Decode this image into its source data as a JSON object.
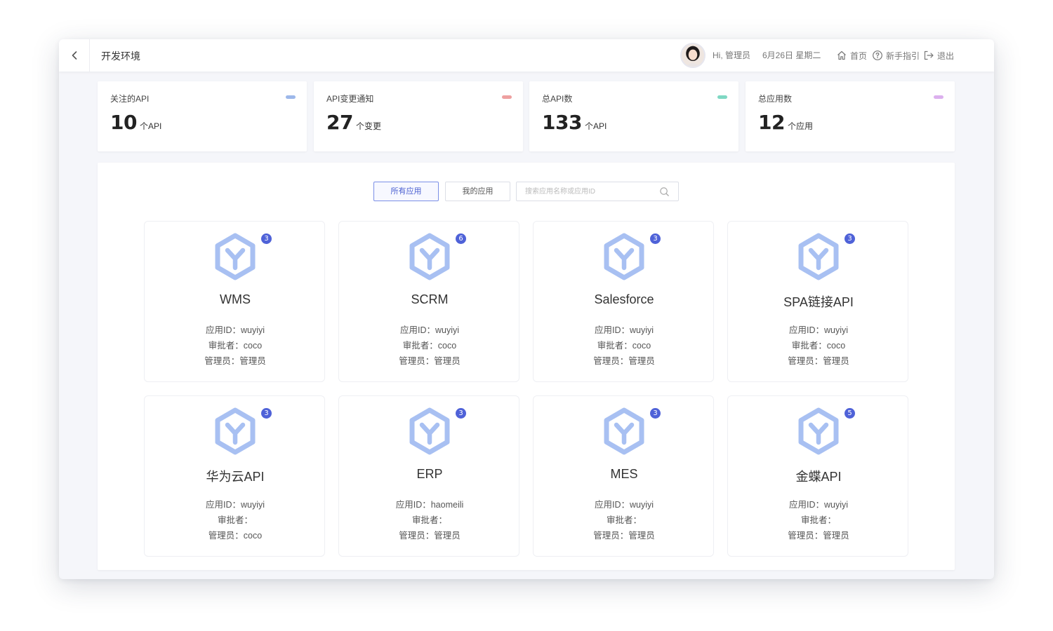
{
  "header": {
    "title": "开发环境",
    "greeting": "Hi, 管理员",
    "date": "6月26日 星期二",
    "home_label": "首页",
    "guide_label": "新手指引",
    "logout_label": "退出"
  },
  "stats": [
    {
      "label": "关注的API",
      "value": "10",
      "unit": "个API",
      "color": "#9db8ea"
    },
    {
      "label": "API变更通知",
      "value": "27",
      "unit": "个变更",
      "color": "#eea0a0"
    },
    {
      "label": "总API数",
      "value": "133",
      "unit": "个API",
      "color": "#7fd8c3"
    },
    {
      "label": "总应用数",
      "value": "12",
      "unit": "个应用",
      "color": "#dcb0ee"
    }
  ],
  "filters": {
    "all_label": "所有应用",
    "mine_label": "我的应用",
    "search_placeholder": "搜索应用名称或应用ID"
  },
  "colors": {
    "accent": "#4f62d8",
    "icon": "#a8c0f2"
  },
  "apps": [
    {
      "name": "WMS",
      "badge": "3",
      "app_id": "应用ID：wuyiyi",
      "approver": "审批者：coco",
      "admin": "管理员：管理员"
    },
    {
      "name": "SCRM",
      "badge": "6",
      "app_id": "应用ID：wuyiyi",
      "approver": "审批者：coco",
      "admin": "管理员：管理员"
    },
    {
      "name": "Salesforce",
      "badge": "3",
      "app_id": "应用ID：wuyiyi",
      "approver": "审批者：coco",
      "admin": "管理员：管理员"
    },
    {
      "name": "SPA链接API",
      "badge": "3",
      "app_id": "应用ID：wuyiyi",
      "approver": "审批者：coco",
      "admin": "管理员：管理员"
    },
    {
      "name": "华为云API",
      "badge": "3",
      "app_id": "应用ID：wuyiyi",
      "approver": "审批者：",
      "admin": "管理员：coco"
    },
    {
      "name": "ERP",
      "badge": "3",
      "app_id": "应用ID：haomeili",
      "approver": "审批者：",
      "admin": "管理员：管理员"
    },
    {
      "name": "MES",
      "badge": "3",
      "app_id": "应用ID：wuyiyi",
      "approver": "审批者：",
      "admin": "管理员：管理员"
    },
    {
      "name": "金蝶API",
      "badge": "5",
      "app_id": "应用ID：wuyiyi",
      "approver": "审批者：",
      "admin": "管理员：管理员"
    }
  ]
}
